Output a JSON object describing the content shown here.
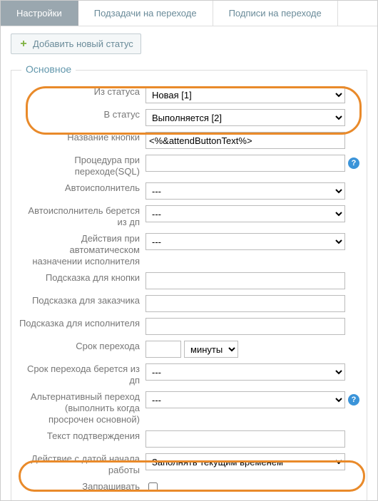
{
  "tabs": {
    "settings": "Настройки",
    "subtasks": "Подзадачи на переходе",
    "signatures": "Подписи на переходе"
  },
  "add_button": "Добавить новый статус",
  "fieldset_title": "Основное",
  "labels": {
    "from_status": "Из статуса",
    "to_status": "В статус",
    "button_name": "Название кнопки",
    "sql_proc": "Процедура при переходе(SQL)",
    "auto_exec": "Автоисполнитель",
    "auto_exec_dp": "Автоисполнитель берется из дп",
    "auto_assign_actions": "Действия при автоматическом назначении исполнителя",
    "btn_hint": "Подсказка для кнопки",
    "customer_hint": "Подсказка для заказчика",
    "exec_hint": "Подсказка для исполнителя",
    "transition_time": "Срок перехода",
    "transition_time_dp": "Срок перехода берется из дп",
    "alt_transition": "Альтернативный переход (выполнить когда просрочен основной)",
    "confirm_text": "Текст подтверждения",
    "start_date_action": "Действие с датой начала работы",
    "ask_confirm": "Запрашивать"
  },
  "values": {
    "from_status": "Новая [1]",
    "to_status": "Выполняется [2]",
    "button_name": "<%&attendButtonText%>",
    "sql_proc": "",
    "auto_exec": "---",
    "auto_exec_dp": "---",
    "auto_assign_actions": "---",
    "btn_hint": "",
    "customer_hint": "",
    "exec_hint": "",
    "transition_time_val": "",
    "transition_time_unit": "минуты",
    "transition_time_dp": "---",
    "alt_transition": "---",
    "confirm_text": "",
    "start_date_action": "Заполнять текущим временем"
  }
}
